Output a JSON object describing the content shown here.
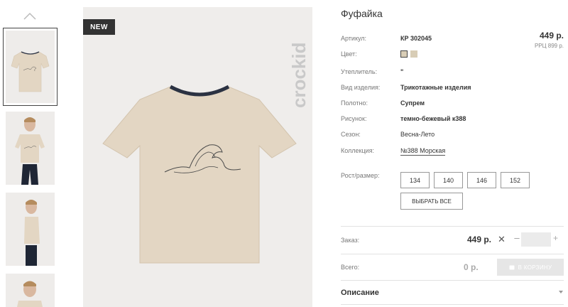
{
  "product": {
    "title": "Фуфайка",
    "price": "449 р.",
    "rrp": "РРЦ 899 р.",
    "badge": "NEW",
    "brand_logo": "crockid"
  },
  "details": {
    "article_label": "Артикул:",
    "article_value": "КР 302045",
    "color_label": "Цвет:",
    "insulation_label": "Утеплитель:",
    "insulation_value": "\"",
    "type_label": "Вид изделия:",
    "type_value": "Трикотажные изделия",
    "fabric_label": "Полотно:",
    "fabric_value": "Супрем",
    "pattern_label": "Рисунок:",
    "pattern_value": "темно-бежевый к388",
    "season_label": "Сезон:",
    "season_value": "Весна-Лето",
    "collection_label": "Коллекция:",
    "collection_value": "№388 Морская"
  },
  "sizes": {
    "label": "Рост/размер:",
    "options": [
      "134",
      "140",
      "146",
      "152"
    ],
    "select_all": "ВЫБРАТЬ ВСЕ"
  },
  "order": {
    "label": "Заказ:",
    "price": "449 р.",
    "times": "✕",
    "minus": "–",
    "plus": "+",
    "quantity": "",
    "total_label": "Всего:",
    "total_value": "0 р.",
    "cart_button": "В КОРЗИНУ"
  },
  "description": {
    "label": "Описание"
  },
  "colors": {
    "swatch": "#d8cdb6",
    "tshirt": "#e3d6c3",
    "accent_dark": "#333333"
  }
}
